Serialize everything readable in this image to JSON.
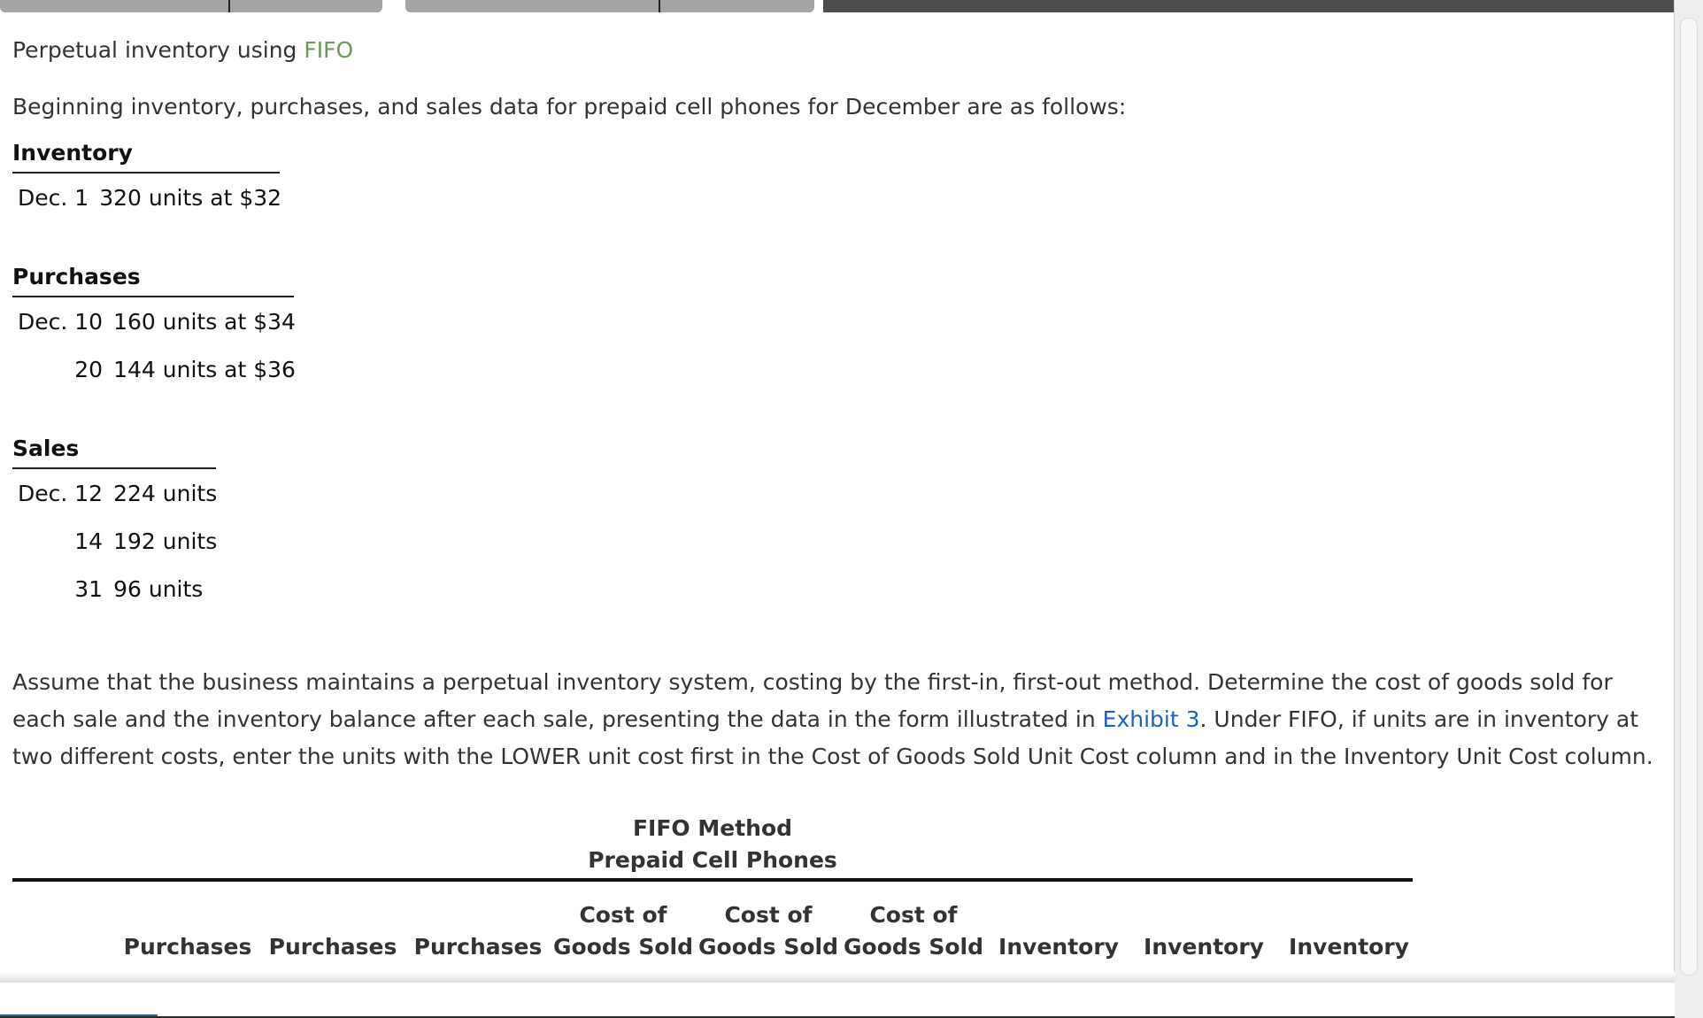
{
  "problem": {
    "title_prefix": "Perpetual inventory using ",
    "title_term": "FIFO",
    "intro": "Beginning inventory, purchases, and sales data for prepaid cell phones for December are as follows:"
  },
  "inventory": {
    "heading": "Inventory",
    "rows": [
      {
        "date": "Dec. 1",
        "detail": "320 units at $32"
      }
    ]
  },
  "purchases": {
    "heading": "Purchases",
    "rows": [
      {
        "date": "Dec. 10",
        "detail": "160 units at $34"
      },
      {
        "date": "20",
        "detail": "144 units at $36"
      }
    ]
  },
  "sales": {
    "heading": "Sales",
    "rows": [
      {
        "date": "Dec. 12",
        "detail": "224 units"
      },
      {
        "date": "14",
        "detail": "192 units"
      },
      {
        "date": "31",
        "detail": "96 units"
      }
    ]
  },
  "instructions": {
    "before_link": "Assume that the business maintains a perpetual inventory system, costing by the first-in, first-out method. Determine the cost of goods sold for each sale and the inventory balance after each sale, presenting the data in the form illustrated in ",
    "link": "Exhibit 3",
    "after_link": ". Under FIFO, if units are in inventory at two different costs, enter the units with the LOWER unit cost first in the Cost of Goods Sold Unit Cost column and in the Inventory Unit Cost column."
  },
  "fifo_table": {
    "caption_line1": "FIFO Method",
    "caption_line2": "Prepaid Cell Phones",
    "columns": [
      {
        "line1": "",
        "line2": "Purchases"
      },
      {
        "line1": "",
        "line2": "Purchases"
      },
      {
        "line1": "",
        "line2": "Purchases"
      },
      {
        "line1": "Cost of",
        "line2": "Goods Sold"
      },
      {
        "line1": "Cost of",
        "line2": "Goods Sold"
      },
      {
        "line1": "Cost of",
        "line2": "Goods Sold"
      },
      {
        "line1": "",
        "line2": "Inventory"
      },
      {
        "line1": "",
        "line2": "Inventory"
      },
      {
        "line1": "",
        "line2": "Inventory"
      }
    ]
  }
}
